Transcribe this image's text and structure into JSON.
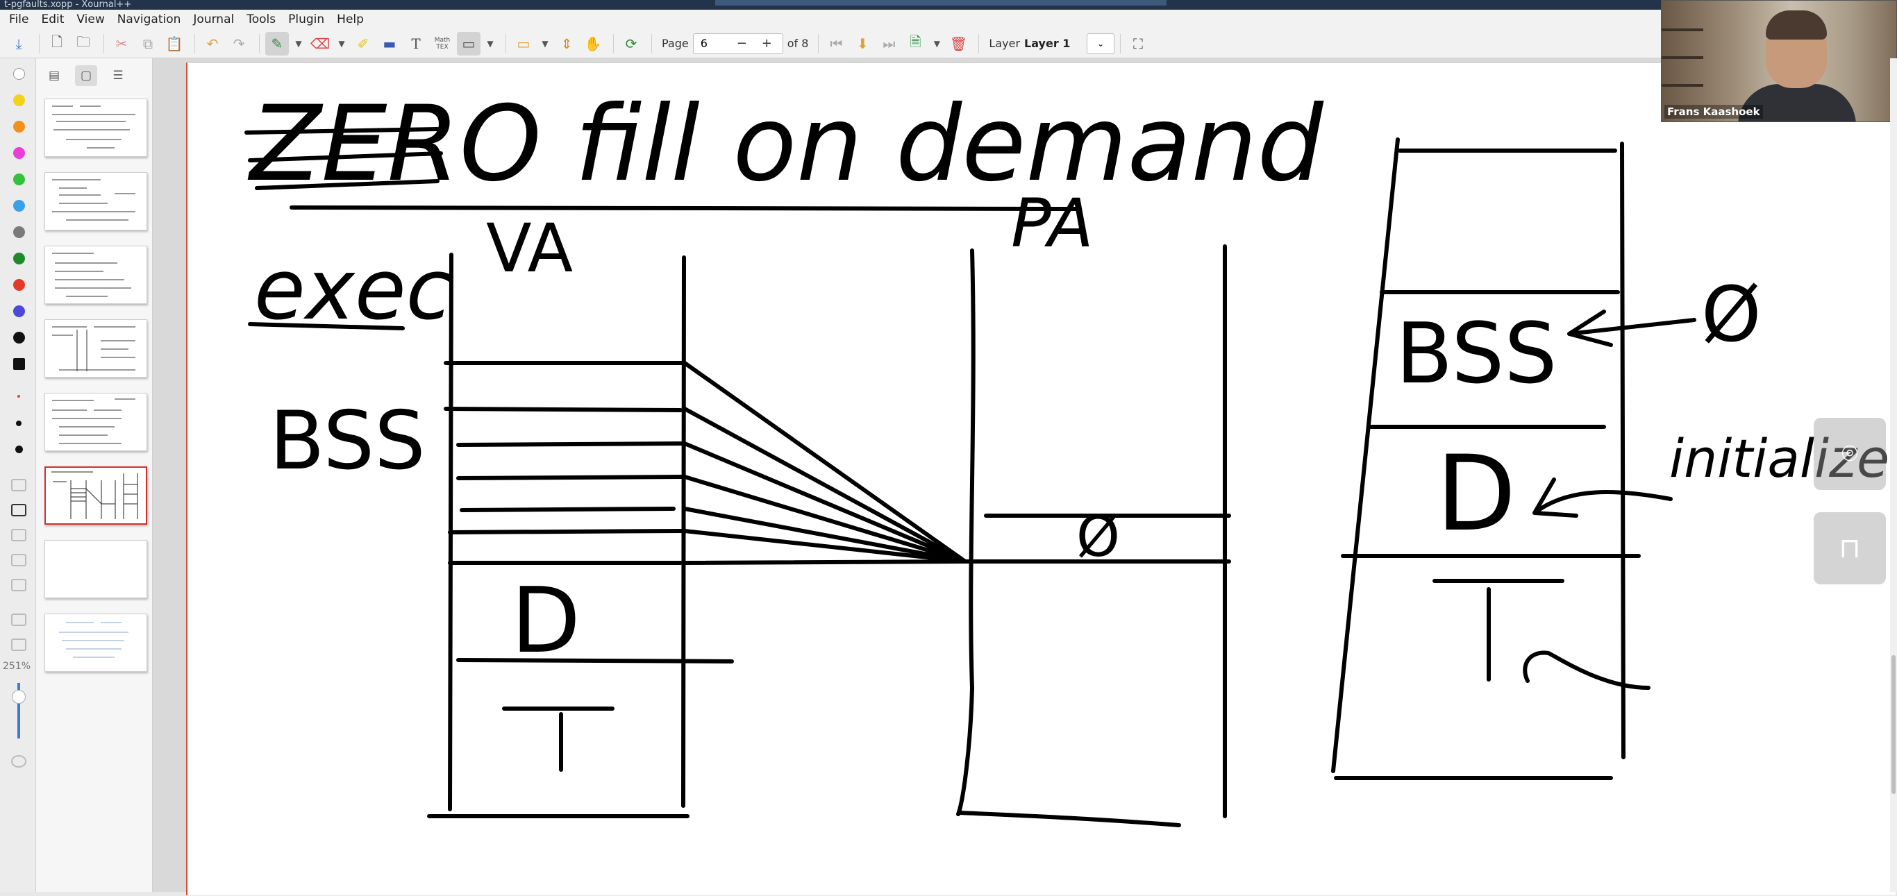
{
  "window": {
    "title": "t-pgfaults.xopp - Xournal++"
  },
  "menu": [
    "File",
    "Edit",
    "View",
    "Navigation",
    "Journal",
    "Tools",
    "Plugin",
    "Help"
  ],
  "toolbar": {
    "page_label": "Page",
    "page_value": "6",
    "page_minus": "−",
    "page_plus": "+",
    "page_total": "of 8",
    "layer_label": "Layer",
    "layer_value": "Layer 1",
    "math_tex_icon": "Math TEX"
  },
  "sidebar": {
    "zoom": "251%",
    "selected_page": 6,
    "page_count": 8
  },
  "colors": [
    "#ffffff",
    "#f2d21b",
    "#f2901b",
    "#e83fd8",
    "#34c23a",
    "#3aa0e8",
    "#7a7a7a",
    "#1f8a2a",
    "#e43a2a",
    "#4a4ad8",
    "#111111",
    "#111111"
  ],
  "video": {
    "name": "Frans Kaashoek"
  },
  "whiteboard": {
    "title": "ZERO fill on demand",
    "left_label": "exec",
    "bss_label": "BSS",
    "va_label": "VA",
    "pa_label": "PA",
    "zero_symbol": "Ø",
    "data_label": "D",
    "text_label": "T",
    "right_bss": "BSS",
    "right_zero": "Ø",
    "right_d": "D",
    "right_t": "T",
    "initialized": "initialized"
  }
}
